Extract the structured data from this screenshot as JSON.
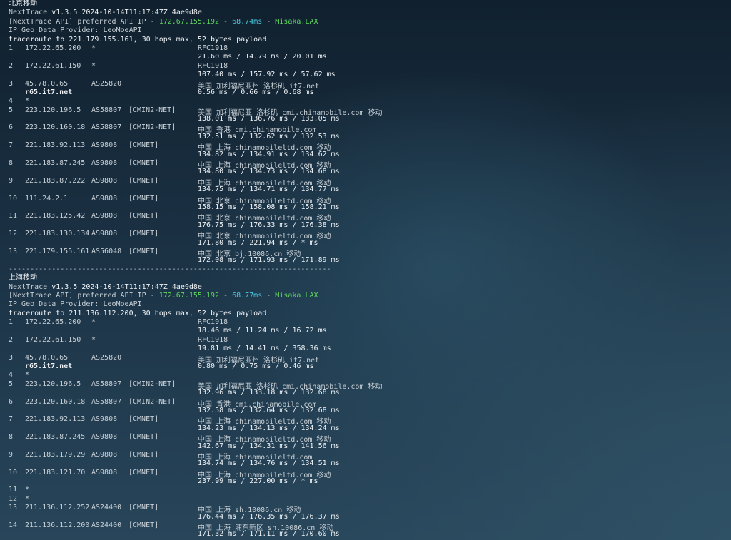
{
  "sections": [
    {
      "title": "北京移动",
      "version_prefix": "NextTrace ",
      "version_value": "v1.3.5 2024-10-14T11:17:47Z 4ae9d8e",
      "api_prefix": "[NextTrace API] preferred API IP - ",
      "api_ip": "172.67.155.192",
      "api_dash1": " - ",
      "api_latency": "68.74ms",
      "api_dash2": " - ",
      "api_node": "Misaka.LAX",
      "geo_provider": "IP Geo Data Provider: LeoMoeAPI",
      "traceroute": "traceroute to 221.179.155.161, 30 hops max, 52 bytes payload",
      "hops": [
        {
          "n": "1",
          "ip": "172.22.65.200",
          "as": "*",
          "tag": "",
          "geo": "RFC1918",
          "host": "",
          "rtt": "21.60 ms / 14.79 ms / 20.01 ms"
        },
        {
          "n": "2",
          "ip": "172.22.61.150",
          "as": "*",
          "tag": "",
          "geo": "RFC1918",
          "host": "",
          "rtt": "107.40 ms / 157.92 ms / 57.62 ms"
        },
        {
          "n": "3",
          "ip": "45.78.0.65",
          "as": "AS25820",
          "tag": "",
          "geo": "美国 加利福尼亚州 洛杉矶  it7.net",
          "host": "r65.it7.net",
          "rtt": "0.56 ms / 0.66 ms / 0.68 ms"
        },
        {
          "n": "4",
          "ip": "*",
          "as": "",
          "tag": "",
          "geo": "",
          "host": "",
          "rtt": ""
        },
        {
          "n": "5",
          "ip": "223.120.196.5",
          "as": "AS58807",
          "tag": "[CMIN2-NET]",
          "geo": "美国 加利福尼亚 洛杉矶  cmi.chinamobile.com  移动",
          "host": "",
          "rtt": "138.01 ms / 136.76 ms / 133.05 ms"
        },
        {
          "n": "6",
          "ip": "223.120.160.18",
          "as": "AS58807",
          "tag": "[CMIN2-NET]",
          "geo": "中国 香港   cmi.chinamobile.com",
          "host": "",
          "rtt": "132.51 ms / 132.62 ms / 132.53 ms"
        },
        {
          "n": "7",
          "ip": "221.183.92.113",
          "as": "AS9808",
          "tag": "[CMNET]",
          "geo": "中国 上海   chinamobileltd.com  移动",
          "host": "",
          "rtt": "134.82 ms / 134.91 ms / 134.62 ms"
        },
        {
          "n": "8",
          "ip": "221.183.87.245",
          "as": "AS9808",
          "tag": "[CMNET]",
          "geo": "中国 上海   chinamobileltd.com  移动",
          "host": "",
          "rtt": "134.80 ms / 134.73 ms / 134.68 ms"
        },
        {
          "n": "9",
          "ip": "221.183.87.222",
          "as": "AS9808",
          "tag": "[CMNET]",
          "geo": "中国 上海   chinamobileltd.com  移动",
          "host": "",
          "rtt": "134.75 ms / 134.71 ms / 134.77 ms"
        },
        {
          "n": "10",
          "ip": "111.24.2.1",
          "as": "AS9808",
          "tag": "[CMNET]",
          "geo": "中国 北京   chinamobileltd.com  移动",
          "host": "",
          "rtt": "158.15 ms / 158.08 ms / 158.21 ms"
        },
        {
          "n": "11",
          "ip": "221.183.125.42",
          "as": "AS9808",
          "tag": "[CMNET]",
          "geo": "中国 北京   chinamobileltd.com  移动",
          "host": "",
          "rtt": "176.75 ms / 176.33 ms / 176.38 ms"
        },
        {
          "n": "12",
          "ip": "221.183.130.134",
          "as": "AS9808",
          "tag": "[CMNET]",
          "geo": "中国 北京   chinamobileltd.com  移动",
          "host": "",
          "rtt": "171.80 ms / 221.94 ms / * ms"
        },
        {
          "n": "13",
          "ip": "221.179.155.161",
          "as": "AS56048",
          "tag": "[CMNET]",
          "geo": "中国 北京   bj.10086.cn  移动",
          "host": "",
          "rtt": "172.08 ms / 171.93 ms / 171.89 ms"
        }
      ]
    },
    {
      "title": "上海移动",
      "version_prefix": "NextTrace ",
      "version_value": "v1.3.5 2024-10-14T11:17:47Z 4ae9d8e",
      "api_prefix": "[NextTrace API] preferred API IP - ",
      "api_ip": "172.67.155.192",
      "api_dash1": " - ",
      "api_latency": "68.77ms",
      "api_dash2": " - ",
      "api_node": "Misaka.LAX",
      "geo_provider": "IP Geo Data Provider: LeoMoeAPI",
      "traceroute": "traceroute to 211.136.112.200, 30 hops max, 52 bytes payload",
      "hops": [
        {
          "n": "1",
          "ip": "172.22.65.200",
          "as": "*",
          "tag": "",
          "geo": "RFC1918",
          "host": "",
          "rtt": "18.46 ms / 11.24 ms / 16.72 ms"
        },
        {
          "n": "2",
          "ip": "172.22.61.150",
          "as": "*",
          "tag": "",
          "geo": "RFC1918",
          "host": "",
          "rtt": "19.81 ms / 14.41 ms / 358.36 ms"
        },
        {
          "n": "3",
          "ip": "45.78.0.65",
          "as": "AS25820",
          "tag": "",
          "geo": "美国 加利福尼亚州 洛杉矶  it7.net",
          "host": "r65.it7.net",
          "rtt": "0.80 ms / 0.75 ms / 0.46 ms"
        },
        {
          "n": "4",
          "ip": "*",
          "as": "",
          "tag": "",
          "geo": "",
          "host": "",
          "rtt": ""
        },
        {
          "n": "5",
          "ip": "223.120.196.5",
          "as": "AS58807",
          "tag": "[CMIN2-NET]",
          "geo": "美国 加利福尼亚 洛杉矶  cmi.chinamobile.com  移动",
          "host": "",
          "rtt": "132.96 ms / 133.18 ms / 132.68 ms"
        },
        {
          "n": "6",
          "ip": "223.120.160.18",
          "as": "AS58807",
          "tag": "[CMIN2-NET]",
          "geo": "中国 香港   cmi.chinamobile.com",
          "host": "",
          "rtt": "132.58 ms / 132.64 ms / 132.68 ms"
        },
        {
          "n": "7",
          "ip": "221.183.92.113",
          "as": "AS9808",
          "tag": "[CMNET]",
          "geo": "中国 上海   chinamobileltd.com  移动",
          "host": "",
          "rtt": "134.23 ms / 134.13 ms / 134.24 ms"
        },
        {
          "n": "8",
          "ip": "221.183.87.245",
          "as": "AS9808",
          "tag": "[CMNET]",
          "geo": "中国 上海   chinamobileltd.com  移动",
          "host": "",
          "rtt": "142.67 ms / 134.31 ms / 141.56 ms"
        },
        {
          "n": "9",
          "ip": "221.183.179.29",
          "as": "AS9808",
          "tag": "[CMNET]",
          "geo": "中国 上海   chinamobileltd.com",
          "host": "",
          "rtt": "134.74 ms / 134.76 ms / 134.51 ms"
        },
        {
          "n": "10",
          "ip": "221.183.121.70",
          "as": "AS9808",
          "tag": "[CMNET]",
          "geo": "中国 上海   chinamobileltd.com  移动",
          "host": "",
          "rtt": "237.99 ms / 227.00 ms / * ms"
        },
        {
          "n": "11",
          "ip": "*",
          "as": "",
          "tag": "",
          "geo": "",
          "host": "",
          "rtt": ""
        },
        {
          "n": "12",
          "ip": "*",
          "as": "",
          "tag": "",
          "geo": "",
          "host": "",
          "rtt": ""
        },
        {
          "n": "13",
          "ip": "211.136.112.252",
          "as": "AS24400",
          "tag": "[CMNET]",
          "geo": "中国 上海   sh.10086.cn  移动",
          "host": "",
          "rtt": "176.44 ms / 176.35 ms / 176.37 ms"
        },
        {
          "n": "14",
          "ip": "211.136.112.200",
          "as": "AS24400",
          "tag": "[CMNET]",
          "geo": "中国 上海  浦东新区 sh.10086.cn  移动",
          "host": "",
          "rtt": "171.32 ms / 171.11 ms / 170.60 ms"
        }
      ]
    }
  ],
  "separator": "---------------------------------------------------------------------------",
  "colors": {
    "ip_green": "#5fd75f",
    "latency_cyan": "#4cc9e0"
  }
}
